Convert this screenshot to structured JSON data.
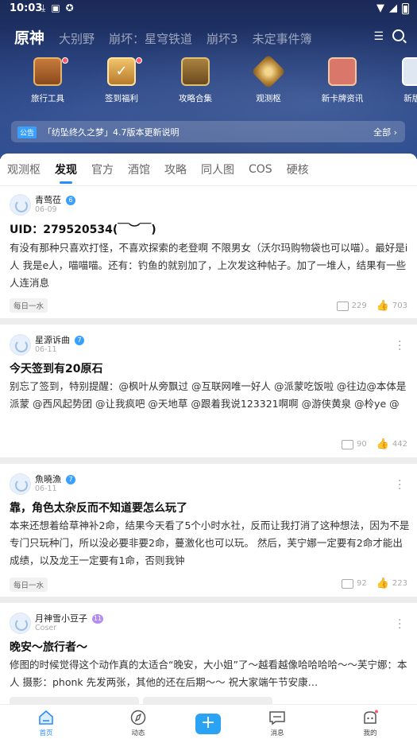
{
  "status_bar": {
    "time": "10:03",
    "left_icons": [
      "download-icon",
      "photo-icon",
      "app-icon"
    ]
  },
  "header": {
    "game_tabs": [
      "原神",
      "大别野",
      "崩坏：星穹铁道",
      "崩坏3",
      "未定事件簿"
    ],
    "active_tab": 0
  },
  "shortcuts": [
    {
      "label": "旅行工具",
      "icon": "treasure-chest-icon",
      "badge": true
    },
    {
      "label": "签到福利",
      "icon": "checkin-icon",
      "badge": true
    },
    {
      "label": "攻略合集",
      "icon": "guide-book-icon",
      "badge": false
    },
    {
      "label": "观测枢",
      "icon": "observatory-icon",
      "badge": false
    },
    {
      "label": "新卡牌资讯",
      "icon": "card-icon",
      "badge": false
    },
    {
      "label": "新版本",
      "icon": "version-icon",
      "badge": false
    }
  ],
  "notice": {
    "tag": "公告",
    "text": "「纺坠终久之梦」4.7版本更新说明",
    "all": "全部"
  },
  "subtabs": [
    "观测枢",
    "发现",
    "官方",
    "酒馆",
    "攻略",
    "同人图",
    "COS",
    "硬核"
  ],
  "active_subtab": 1,
  "posts": [
    {
      "user": "青莺莅",
      "level": "6",
      "level_color": "#3aa0ff",
      "date": "06-09",
      "title": "UID：279520534(￣︶￣)",
      "body": "有没有那种只喜欢打怪，不喜欢探索的老登啊 不限男女（沃尔玛购物袋也可以喵）。最好是i人 我是e人，喵喵喵。还有：钓鱼的就别加了，上次发这种帖子。加了一堆人，结果有一些人连消息",
      "tag": "每日一水",
      "comments": "229",
      "likes": "703"
    },
    {
      "user": "星源诉曲",
      "level": "7",
      "level_color": "#3aa0ff",
      "date": "06-11",
      "title": "今天签到有20原石",
      "body": "别忘了签到，特别提醒：@枫叶从旁飘过 @互联网唯一好人 @派蒙吃饭啦 @往边@本体是派蒙 @西风起势团 @让我疯吧 @天地草 @跟着我说123321啊啊 @游侠黄泉 @柃ye @",
      "tag": "",
      "comments": "90",
      "likes": "442"
    },
    {
      "user": "魚曉漁",
      "level": "7",
      "level_color": "#3aa0ff",
      "date": "06-11",
      "title": "靠，角色太杂反而不知道要怎么玩了",
      "body": "本来还想着给草神补2命，结果今天看了5个小时水社，反而让我打消了这种想法，因为不是专门只玩种门，所以没必要非要2命，蔓激化也可以玩。 然后，芙宁娜一定要有2命才能出成绩，以及龙王一定要有1命，否则我钟",
      "tag": "每日一水",
      "comments": "92",
      "likes": "223"
    },
    {
      "user": "月神雪小豆子",
      "level": "11",
      "level_color": "#b48cf0",
      "date": "Coser",
      "title": "晚安～旅行者～",
      "body": "修图的时候觉得这个动作真的太适合“晚安，大小姐”了～越看越像哈哈哈哈～～芙宁娜：本人 摄影：phonk 先发两张，其他的还在后期～～ 祝大家端午节安康…",
      "tag": "",
      "comments": "",
      "likes": ""
    }
  ],
  "bottom_nav": [
    {
      "label": "首页",
      "icon": "home-icon"
    },
    {
      "label": "动态",
      "icon": "compass-icon"
    },
    {
      "label": "",
      "icon": "plus-icon"
    },
    {
      "label": "消息",
      "icon": "message-icon"
    },
    {
      "label": "我的",
      "icon": "profile-icon"
    }
  ],
  "colors": {
    "accent": "#2b8cff",
    "header_bg": "#1f3266",
    "plus_button": "#2ba3f5"
  }
}
